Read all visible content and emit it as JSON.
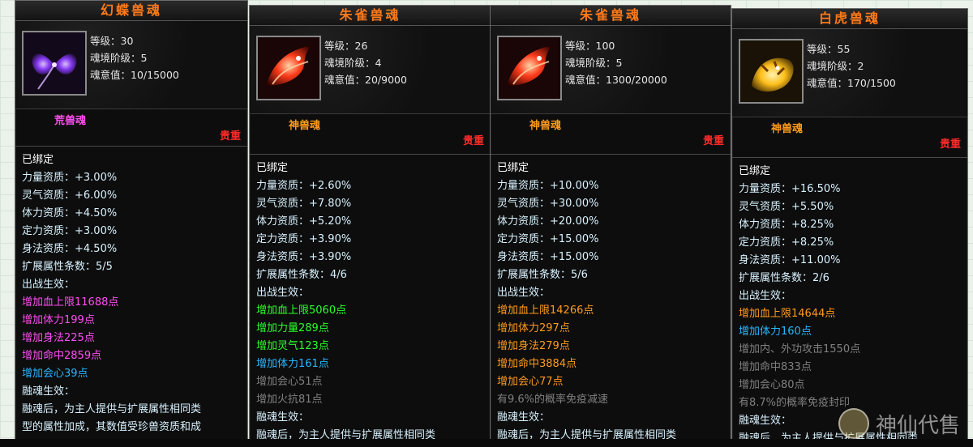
{
  "panels": [
    {
      "id": "p1",
      "title": "幻蝶兽魂",
      "stats": [
        "等级：30",
        "魂境阶级：5",
        "魂意值：10/15000"
      ],
      "type": "荒兽魂",
      "type_color": "#ff4df2",
      "rarity": "贵重",
      "lines": [
        {
          "text": "已绑定",
          "color": "white"
        },
        {
          "text": "力量资质：+3.00%",
          "color": "cyan"
        },
        {
          "text": "灵气资质：+6.00%",
          "color": "cyan"
        },
        {
          "text": "体力资质：+4.50%",
          "color": "cyan"
        },
        {
          "text": "定力资质：+3.00%",
          "color": "cyan"
        },
        {
          "text": "身法资质：+4.50%",
          "color": "cyan"
        },
        {
          "text": "扩展属性条数：5/5",
          "color": "cyan"
        },
        {
          "text": "出战生效：",
          "color": "cyan"
        },
        {
          "text": "增加血上限11688点",
          "color": "pink"
        },
        {
          "text": "增加体力199点",
          "color": "pink"
        },
        {
          "text": "增加身法225点",
          "color": "pink"
        },
        {
          "text": "增加命中2859点",
          "color": "pink"
        },
        {
          "text": "增加会心39点",
          "color": "blue"
        },
        {
          "text": "融魂生效：",
          "color": "cyan"
        },
        {
          "text": "融魂后，为主人提供与扩展属性相同类",
          "color": "cyan"
        },
        {
          "text": "型的属性加成，其数值受珍兽资质和成",
          "color": "cyan"
        }
      ]
    },
    {
      "id": "p2",
      "title": "朱雀兽魂",
      "stats": [
        "等级：26",
        "魂境阶级：4",
        "魂意值：20/9000"
      ],
      "type": "神兽魂",
      "type_color": "#ff9b1a",
      "rarity": "贵重",
      "lines": [
        {
          "text": "已绑定",
          "color": "white"
        },
        {
          "text": "力量资质：+2.60%",
          "color": "cyan"
        },
        {
          "text": "灵气资质：+7.80%",
          "color": "cyan"
        },
        {
          "text": "体力资质：+5.20%",
          "color": "cyan"
        },
        {
          "text": "定力资质：+3.90%",
          "color": "cyan"
        },
        {
          "text": "身法资质：+3.90%",
          "color": "cyan"
        },
        {
          "text": "扩展属性条数：4/6",
          "color": "cyan"
        },
        {
          "text": "出战生效：",
          "color": "cyan"
        },
        {
          "text": "增加血上限5060点",
          "color": "green"
        },
        {
          "text": "增加力量289点",
          "color": "green"
        },
        {
          "text": "增加灵气123点",
          "color": "green"
        },
        {
          "text": "增加体力161点",
          "color": "blue"
        },
        {
          "text": "增加会心51点",
          "color": "gray"
        },
        {
          "text": "增加火抗81点",
          "color": "gray"
        },
        {
          "text": "融魂生效：",
          "color": "cyan"
        },
        {
          "text": "融魂后，为主人提供与扩展属性相同类",
          "color": "cyan"
        }
      ]
    },
    {
      "id": "p3",
      "title": "朱雀兽魂",
      "stats": [
        "等级：100",
        "魂境阶级：5",
        "魂意值：1300/20000"
      ],
      "type": "神兽魂",
      "type_color": "#ff9b1a",
      "rarity": "贵重",
      "lines": [
        {
          "text": "已绑定",
          "color": "white"
        },
        {
          "text": "力量资质：+10.00%",
          "color": "cyan"
        },
        {
          "text": "灵气资质：+30.00%",
          "color": "cyan"
        },
        {
          "text": "体力资质：+20.00%",
          "color": "cyan"
        },
        {
          "text": "定力资质：+15.00%",
          "color": "cyan"
        },
        {
          "text": "身法资质：+15.00%",
          "color": "cyan"
        },
        {
          "text": "扩展属性条数：5/6",
          "color": "cyan"
        },
        {
          "text": "出战生效：",
          "color": "cyan"
        },
        {
          "text": "增加血上限14266点",
          "color": "orange"
        },
        {
          "text": "增加体力297点",
          "color": "orange"
        },
        {
          "text": "增加身法279点",
          "color": "orange"
        },
        {
          "text": "增加命中3884点",
          "color": "orange"
        },
        {
          "text": "增加会心77点",
          "color": "orange"
        },
        {
          "text": "有9.6%的概率免疫减速",
          "color": "gray"
        },
        {
          "text": "融魂生效：",
          "color": "cyan"
        },
        {
          "text": "融魂后，为主人提供与扩展属性相同类",
          "color": "cyan"
        }
      ]
    },
    {
      "id": "p4",
      "title": "白虎兽魂",
      "stats": [
        "等级：55",
        "魂境阶级：2",
        "魂意值：170/1500"
      ],
      "type": "神兽魂",
      "type_color": "#ff9b1a",
      "rarity": "贵重",
      "lines": [
        {
          "text": "已绑定",
          "color": "white"
        },
        {
          "text": "力量资质：+16.50%",
          "color": "cyan"
        },
        {
          "text": "灵气资质：+5.50%",
          "color": "cyan"
        },
        {
          "text": "体力资质：+8.25%",
          "color": "cyan"
        },
        {
          "text": "定力资质：+8.25%",
          "color": "cyan"
        },
        {
          "text": "身法资质：+11.00%",
          "color": "cyan"
        },
        {
          "text": "扩展属性条数：2/6",
          "color": "cyan"
        },
        {
          "text": "出战生效：",
          "color": "cyan"
        },
        {
          "text": "增加血上限14644点",
          "color": "orange"
        },
        {
          "text": "增加体力160点",
          "color": "blue"
        },
        {
          "text": "增加内、外功攻击1550点",
          "color": "gray"
        },
        {
          "text": "增加命中833点",
          "color": "gray"
        },
        {
          "text": "增加会心80点",
          "color": "gray"
        },
        {
          "text": "有8.7%的概率免疫封印",
          "color": "gray"
        },
        {
          "text": "融魂生效：",
          "color": "cyan"
        },
        {
          "text": "融魂后，为主人提供与扩展属性相同类",
          "color": "cyan"
        }
      ]
    }
  ],
  "watermark": {
    "text": "神仙代售"
  },
  "colors": {
    "white": "#ffffff",
    "cyan": "#d8f2ff",
    "pink": "#ff4df2",
    "blue": "#27b7ff",
    "green": "#2aff2a",
    "orange": "#ff9b1a",
    "gray": "#808080",
    "rarity": "#ff2a2a",
    "title": "#ff7a1a"
  },
  "icons": {
    "p1": "butterfly-soul-icon",
    "p2": "phoenix-soul-icon",
    "p3": "phoenix-soul-icon",
    "p4": "tiger-soul-icon"
  }
}
